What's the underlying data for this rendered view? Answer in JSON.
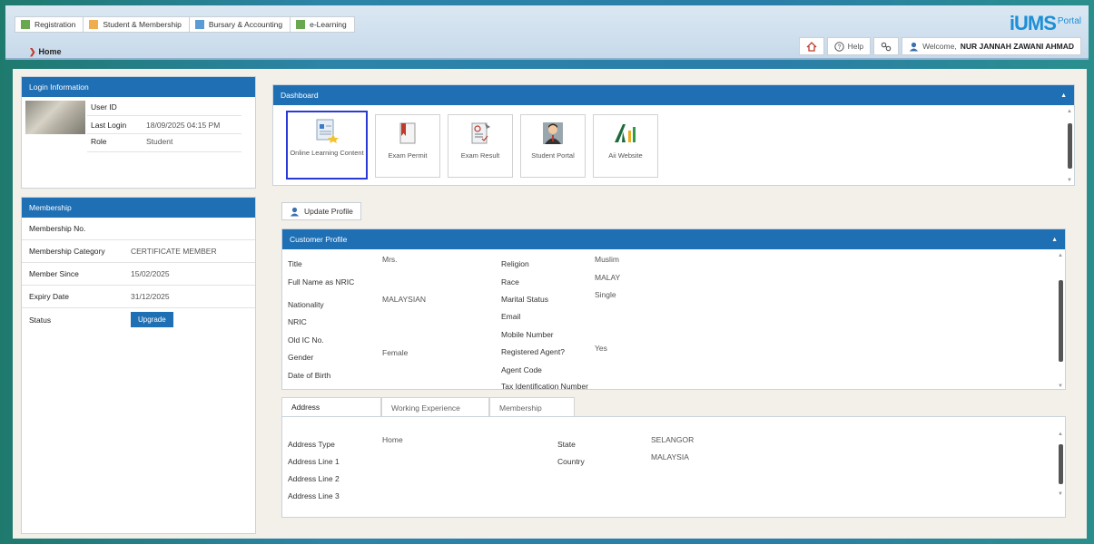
{
  "nav": {
    "tabs": [
      {
        "label": "Registration",
        "color": "#6aa84f"
      },
      {
        "label": "Student & Membership",
        "color": "#f0ad4e"
      },
      {
        "label": "Bursary & Accounting",
        "color": "#5b9bd5"
      },
      {
        "label": "e-Learning",
        "color": "#6aa84f"
      }
    ],
    "breadcrumb": "Home"
  },
  "logo": {
    "main": "iUMS",
    "portal": "Portal"
  },
  "userbar": {
    "help": "Help",
    "welcome_prefix": "Welcome,",
    "user_name": "NUR JANNAH ZAWANI AHMAD"
  },
  "login_info": {
    "title": "Login Information",
    "user_id_label": "User ID",
    "user_id_value": "",
    "last_login_label": "Last Login",
    "last_login_value": "18/09/2025 04:15 PM",
    "role_label": "Role",
    "role_value": "Student"
  },
  "membership": {
    "title": "Membership",
    "rows": [
      {
        "label": "Membership No.",
        "value": ""
      },
      {
        "label": "Membership Category",
        "value": "CERTIFICATE MEMBER"
      },
      {
        "label": "Member Since",
        "value": "15/02/2025"
      },
      {
        "label": "Expiry Date",
        "value": "31/12/2025"
      }
    ],
    "status_label": "Status",
    "upgrade_label": "Upgrade"
  },
  "dashboard": {
    "title": "Dashboard",
    "tiles": [
      {
        "label": "Online Learning Content",
        "icon": "document-icon"
      },
      {
        "label": "Exam Permit",
        "icon": "permit-icon"
      },
      {
        "label": "Exam Result",
        "icon": "checklist-icon"
      },
      {
        "label": "Student Portal",
        "icon": "person-icon"
      },
      {
        "label": "Aii Website",
        "icon": "aii-logo-icon"
      }
    ]
  },
  "update_profile_label": "Update Profile",
  "customer_profile": {
    "title": "Customer Profile",
    "left": [
      {
        "label": "Title",
        "value": "Mrs."
      },
      {
        "label": "Full Name as NRIC",
        "value": ""
      },
      {
        "label": "Nationality",
        "value": "MALAYSIAN"
      },
      {
        "label": "NRIC",
        "value": ""
      },
      {
        "label": "Old IC No.",
        "value": ""
      },
      {
        "label": "Gender",
        "value": "Female"
      },
      {
        "label": "Date of Birth",
        "value": ""
      }
    ],
    "right": [
      {
        "label": "Religion",
        "value": "Muslim"
      },
      {
        "label": "Race",
        "value": "MALAY"
      },
      {
        "label": "Marital Status",
        "value": "Single"
      },
      {
        "label": "Email",
        "value": ""
      },
      {
        "label": "Mobile Number",
        "value": ""
      },
      {
        "label": "Registered Agent?",
        "value": "Yes"
      },
      {
        "label": "Agent Code",
        "value": ""
      },
      {
        "label": "Tax Identification Number",
        "value": ""
      }
    ]
  },
  "address_tabs": {
    "tabs": [
      "Address",
      "Working Experience",
      "Membership"
    ],
    "fields_left": [
      {
        "label": "Address Type",
        "value": "Home"
      },
      {
        "label": "Address Line 1",
        "value": ""
      },
      {
        "label": "Address Line 2",
        "value": ""
      },
      {
        "label": "Address Line 3",
        "value": ""
      }
    ],
    "fields_right": [
      {
        "label": "State",
        "value": "SELANGOR"
      },
      {
        "label": "Country",
        "value": "MALAYSIA"
      }
    ]
  }
}
